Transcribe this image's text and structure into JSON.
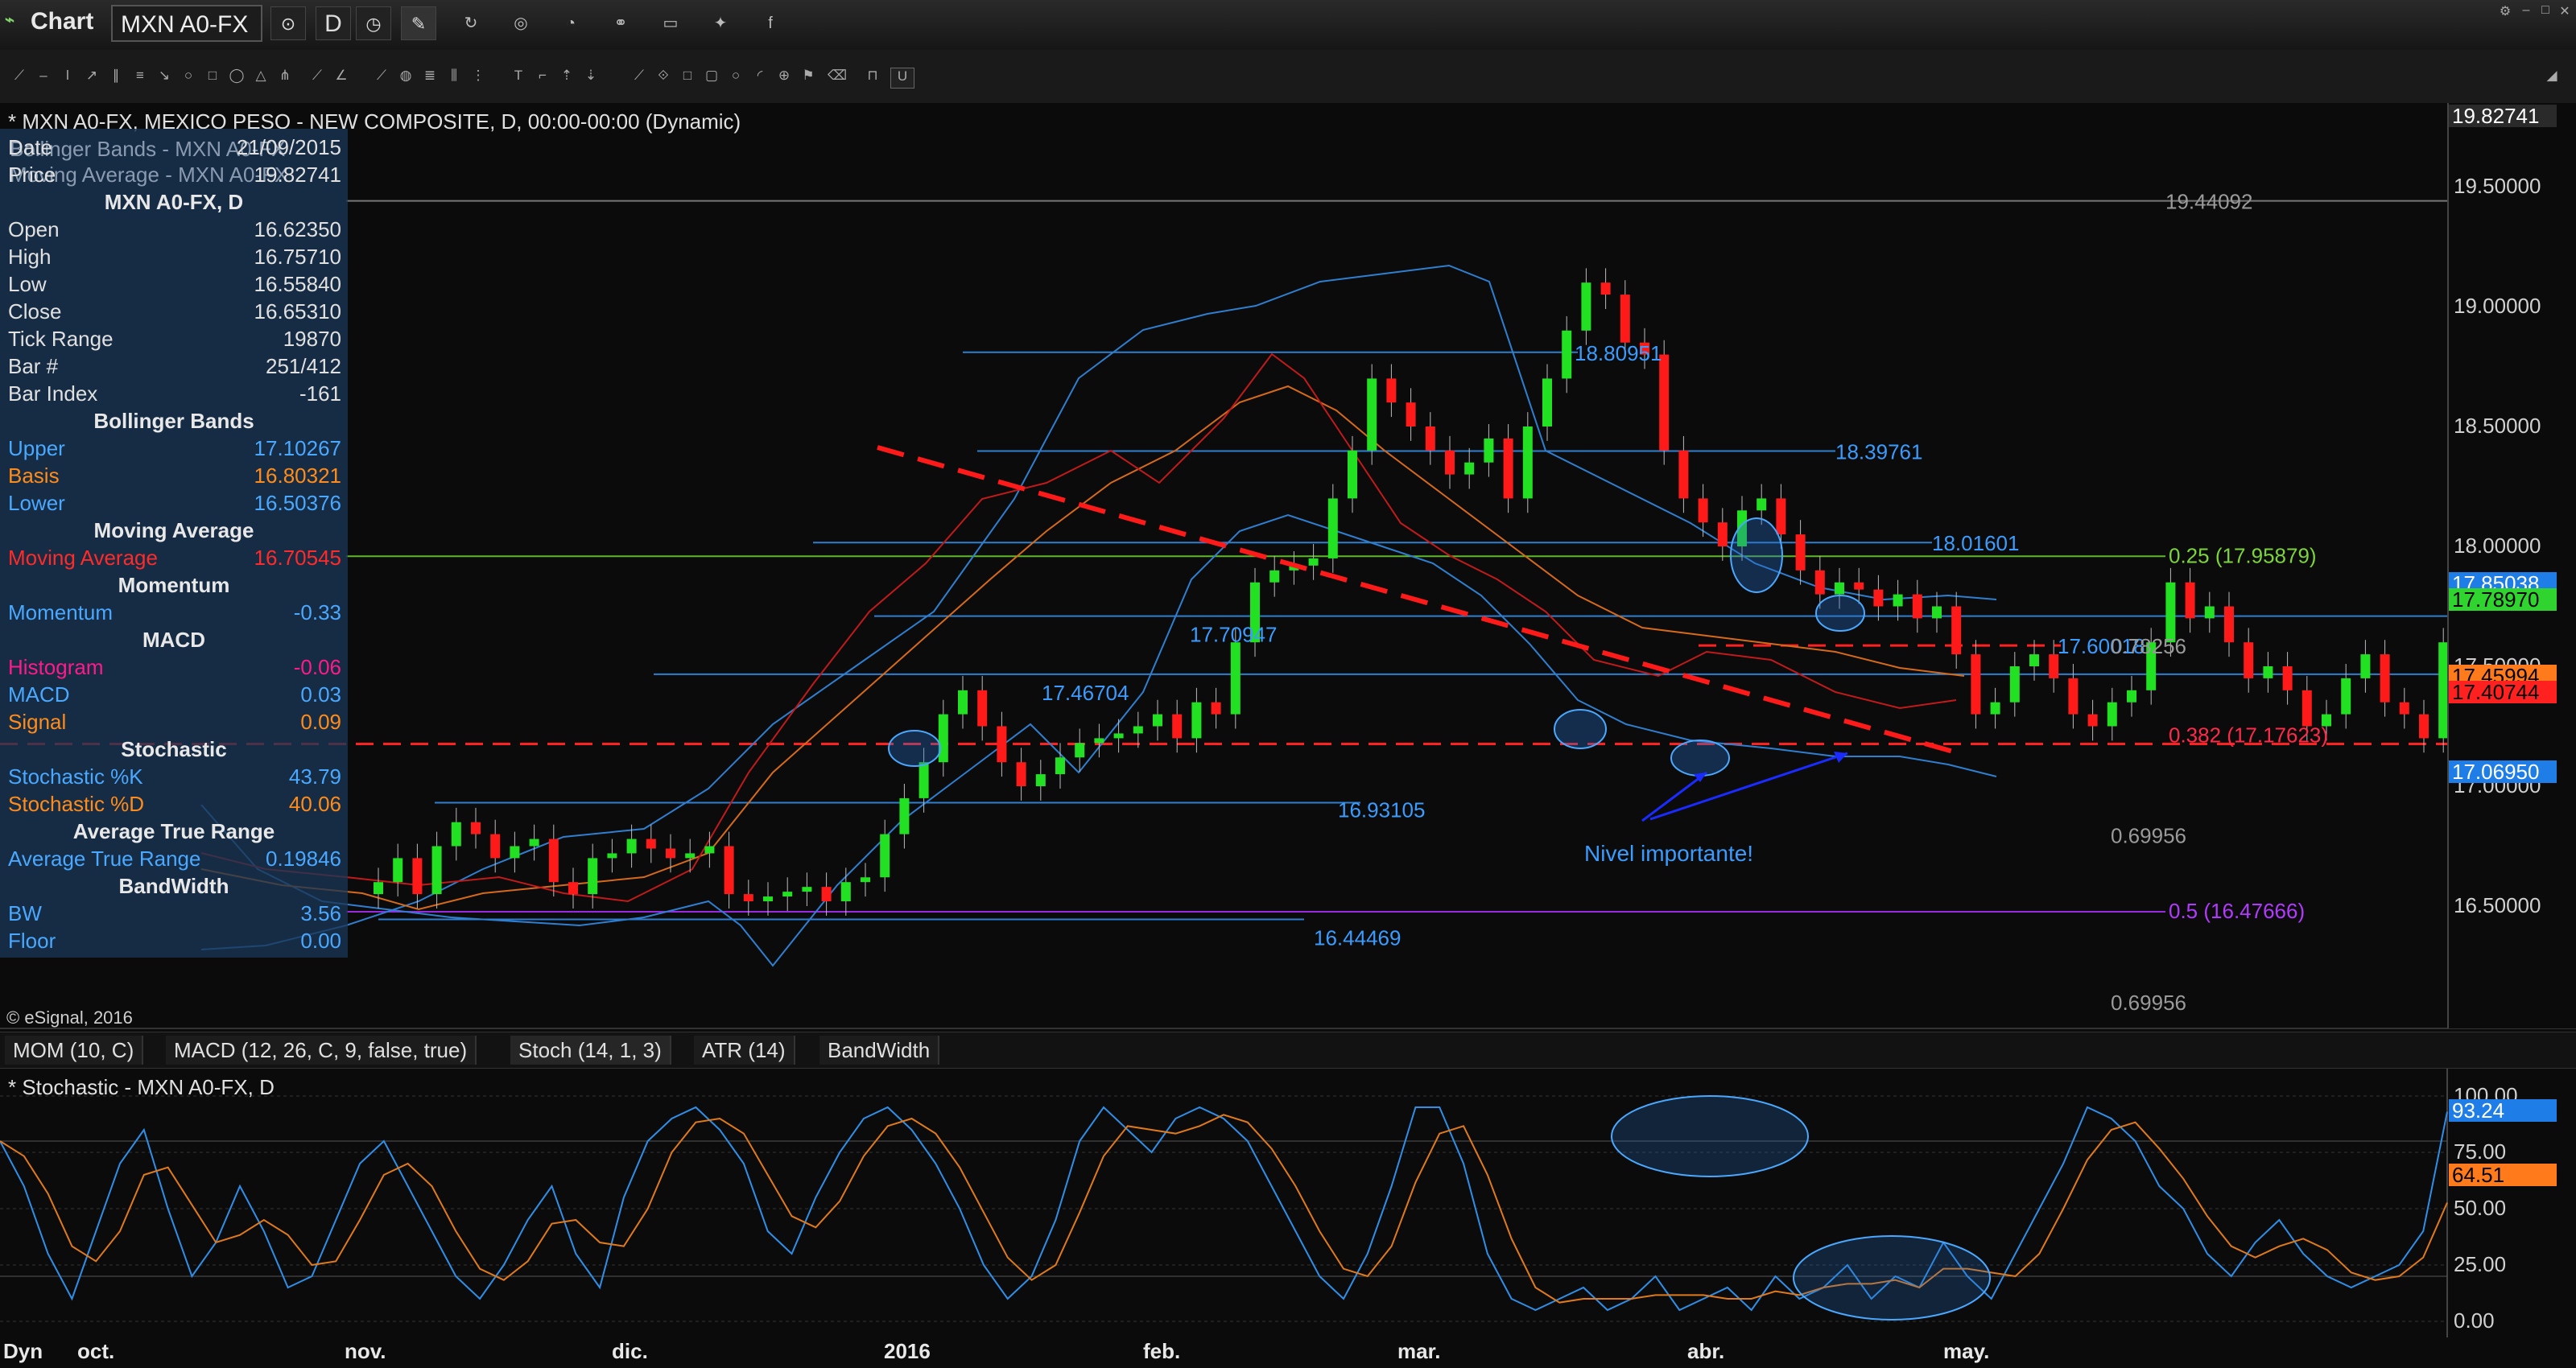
{
  "window": {
    "title": "Chart",
    "symbol": "MXN A0-FX",
    "interval": "D"
  },
  "toolbar_icons": [
    "link-icon",
    "interval-icon",
    "crosshair-icon",
    "pencil-icon",
    "refresh-icon",
    "target-icon",
    "clock-icon",
    "link-chain-icon",
    "chat-icon",
    "twitter-icon",
    "facebook-icon"
  ],
  "chart": {
    "header": "* MXN A0-FX, MEXICO PESO - NEW COMPOSITE, D, 00:00-00:00 (Dynamic)",
    "copyright": "© eSignal, 2016",
    "annotation": "Nivel importante!"
  },
  "data_window": {
    "rows": [
      {
        "k": "Date",
        "v": "21/09/2015",
        "color": "#e0e0e0"
      },
      {
        "k": "Price",
        "v": "19.82741",
        "color": "#e0e0e0"
      },
      {
        "k": "MXN A0-FX, D",
        "v": "",
        "header": true
      },
      {
        "k": "Open",
        "v": "16.62350",
        "color": "#e0e0e0"
      },
      {
        "k": "High",
        "v": "16.75710",
        "color": "#e0e0e0"
      },
      {
        "k": "Low",
        "v": "16.55840",
        "color": "#e0e0e0"
      },
      {
        "k": "Close",
        "v": "16.65310",
        "color": "#e0e0e0"
      },
      {
        "k": "Tick Range",
        "v": "19870",
        "color": "#e0e0e0"
      },
      {
        "k": "Bar #",
        "v": "251/412",
        "color": "#e0e0e0"
      },
      {
        "k": "Bar Index",
        "v": "-161",
        "color": "#e0e0e0"
      },
      {
        "k": "Bollinger Bands",
        "v": "",
        "header": true
      },
      {
        "k": "Upper",
        "v": "17.10267",
        "color": "#4aa8ff"
      },
      {
        "k": "Basis",
        "v": "16.80321",
        "color": "#ff8c1a"
      },
      {
        "k": "Lower",
        "v": "16.50376",
        "color": "#4aa8ff"
      },
      {
        "k": "Moving Average",
        "v": "",
        "header": true
      },
      {
        "k": "Moving Average",
        "v": "16.70545",
        "color": "#ff2a2a"
      },
      {
        "k": "Momentum",
        "v": "",
        "header": true
      },
      {
        "k": "Momentum",
        "v": "-0.33",
        "color": "#4aa8ff"
      },
      {
        "k": "MACD",
        "v": "",
        "header": true
      },
      {
        "k": "Histogram",
        "v": "-0.06",
        "color": "#ff1a8c"
      },
      {
        "k": "MACD",
        "v": "0.03",
        "color": "#4aa8ff"
      },
      {
        "k": "Signal",
        "v": "0.09",
        "color": "#ff8c1a"
      },
      {
        "k": "Stochastic",
        "v": "",
        "header": true
      },
      {
        "k": "Stochastic %K",
        "v": "43.79",
        "color": "#4aa8ff"
      },
      {
        "k": "Stochastic %D",
        "v": "40.06",
        "color": "#ff8c1a"
      },
      {
        "k": "Average True Range",
        "v": "",
        "header": true
      },
      {
        "k": "Average True Range",
        "v": "0.19846",
        "color": "#4aa8ff"
      },
      {
        "k": "BandWidth",
        "v": "",
        "header": true
      },
      {
        "k": "BW",
        "v": "3.56",
        "color": "#4aa8ff"
      },
      {
        "k": "Floor",
        "v": "0.00",
        "color": "#4aa8ff"
      }
    ],
    "legend_behind": [
      "Bollinger Bands - MXN A0-FX",
      "Moving Average - MXN A0-FX"
    ]
  },
  "price_axis": {
    "ticks": [
      "19.50000",
      "19.00000",
      "18.50000",
      "18.00000",
      "17.50000",
      "17.00000",
      "16.50000"
    ],
    "tags": [
      {
        "text": "19.82741",
        "bg": "#2a2a2a",
        "fg": "#ffffff"
      },
      {
        "text": "17.85038",
        "bg": "#1f7de8",
        "fg": "#ffffff"
      },
      {
        "text": "17.78970",
        "bg": "#2fd42f",
        "fg": "#000000"
      },
      {
        "text": "17.45994",
        "bg": "#ff7a1a",
        "fg": "#000000"
      },
      {
        "text": "17.40744",
        "bg": "#ff2020",
        "fg": "#000000"
      },
      {
        "text": "17.06950",
        "bg": "#1f7de8",
        "fg": "#ffffff"
      }
    ]
  },
  "price_levels": [
    {
      "label": "19.44092",
      "color": "#9a9a9a"
    },
    {
      "label": "18.80951",
      "color": "#3b9cff"
    },
    {
      "label": "18.39761",
      "color": "#3b9cff"
    },
    {
      "label": "18.01601",
      "color": "#3b9cff"
    },
    {
      "label": "17.70947",
      "color": "#3b9cff"
    },
    {
      "label": "17.46704",
      "color": "#3b9cff"
    },
    {
      "label": "16.93105",
      "color": "#3b9cff"
    },
    {
      "label": "16.44469",
      "color": "#3b9cff"
    },
    {
      "label": "17.60018",
      "color": "#3b9cff"
    },
    {
      "label": "0.78256",
      "color": "#9a9a9a"
    },
    {
      "label": "0.69956",
      "color": "#9a9a9a"
    },
    {
      "label": "0.69956",
      "color": "#9a9a9a"
    }
  ],
  "fib_levels": [
    {
      "label": "0.25 (17.95879)",
      "color": "#7dd43a"
    },
    {
      "label": "0.382 (17.17623)",
      "color": "#ff2a4a"
    },
    {
      "label": "0.5 (16.47666)",
      "color": "#b23aff"
    }
  ],
  "study_tabs": [
    "MOM (10, C)",
    "MACD (12, 26, C, 9, false, true)",
    "Stoch (14, 1, 3)",
    "ATR (14)",
    "BandWidth"
  ],
  "active_tab": 2,
  "stochastic": {
    "title": "* Stochastic - MXN A0-FX, D",
    "ticks": [
      "100.00",
      "75.00",
      "50.00",
      "25.00",
      "0.00"
    ],
    "tags": [
      {
        "text": "93.24",
        "bg": "#1f7de8",
        "fg": "#ffffff"
      },
      {
        "text": "64.51",
        "bg": "#ff7a1a",
        "fg": "#000000"
      }
    ]
  },
  "time_axis": {
    "prefix": "Dyn",
    "labels": [
      "oct.",
      "nov.",
      "dic.",
      "2016",
      "feb.",
      "mar.",
      "abr.",
      "may."
    ]
  }
}
